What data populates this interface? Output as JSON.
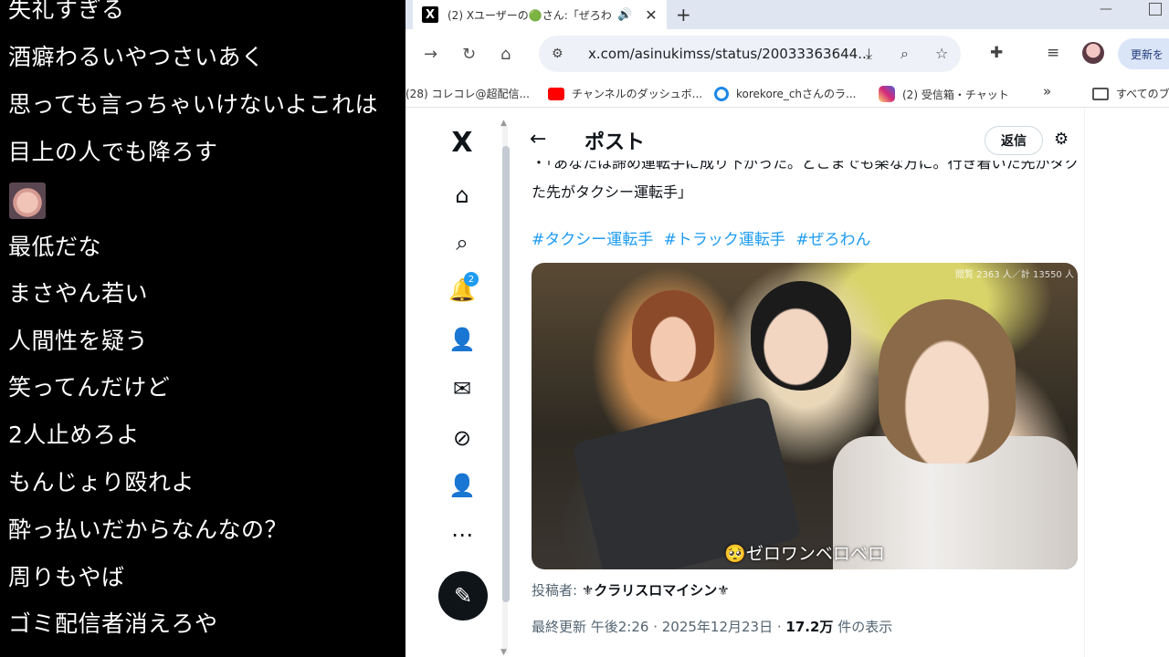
{
  "comments": [
    "失礼すぎる",
    "酒癖わるいやつさいあく",
    "思っても言っちゃいけないよこれは",
    "目上の人でも降ろす",
    "最低だな",
    "まさやん若い",
    "人間性を疑う",
    "笑ってんだけど",
    "2人止めろよ",
    "もんじょり殴れよ",
    "酔っ払いだからなんなの？",
    "周りもやば",
    "ゴミ配信者消えろや"
  ],
  "browser": {
    "tab": {
      "title": "(2) Xユーザーの🟢さん:「ぜろわ",
      "logo": "X",
      "audio_icon": "speaker-icon",
      "close": "✕"
    },
    "new_tab": "+",
    "url": "x.com/asinukimss/status/20033363644...",
    "update_label": "更新を",
    "bookmarks": [
      {
        "label": "(28) コレコレ@超配信...",
        "icon": "none"
      },
      {
        "label": "チャンネルのダッシュボ...",
        "icon": "youtube"
      },
      {
        "label": "korekore_chさんのラ...",
        "icon": "loop"
      },
      {
        "label": "(2) 受信箱・チャット",
        "icon": "instagram"
      },
      {
        "label": "»",
        "icon": "none"
      },
      {
        "label": "すべてのブ",
        "icon": "folder"
      }
    ],
    "colors": {
      "youtube": "#ff0000",
      "loop": "#1e88e5",
      "instagram": "#d62976",
      "x_blue": "#1d9bf0"
    }
  },
  "x": {
    "logo": "X",
    "notification_count": "2",
    "header_title": "ポスト",
    "reply_label": "返信",
    "body_line1": "・「あなたは諦め運転手に成り下がった。どこまでも楽な方に。行き着いた先がタクシー運転手」",
    "body_line2": "た先がタクシー運転手」",
    "hashtags": [
      "#タクシー運転手",
      "#トラック運転手",
      "#ぜろわん"
    ],
    "media": {
      "caption": "🥺ゼロワンベロベロ",
      "watermark": "閲覧 2363 人／計 13550 人"
    },
    "poster_prefix": "投稿者: ",
    "poster_name": "⚜クラリスロマイシン⚜",
    "meta_prefix": "最終更新 午後2:26 · 2025年12月23日 · ",
    "views": "17.2万",
    "meta_suffix": " 件の表示"
  }
}
